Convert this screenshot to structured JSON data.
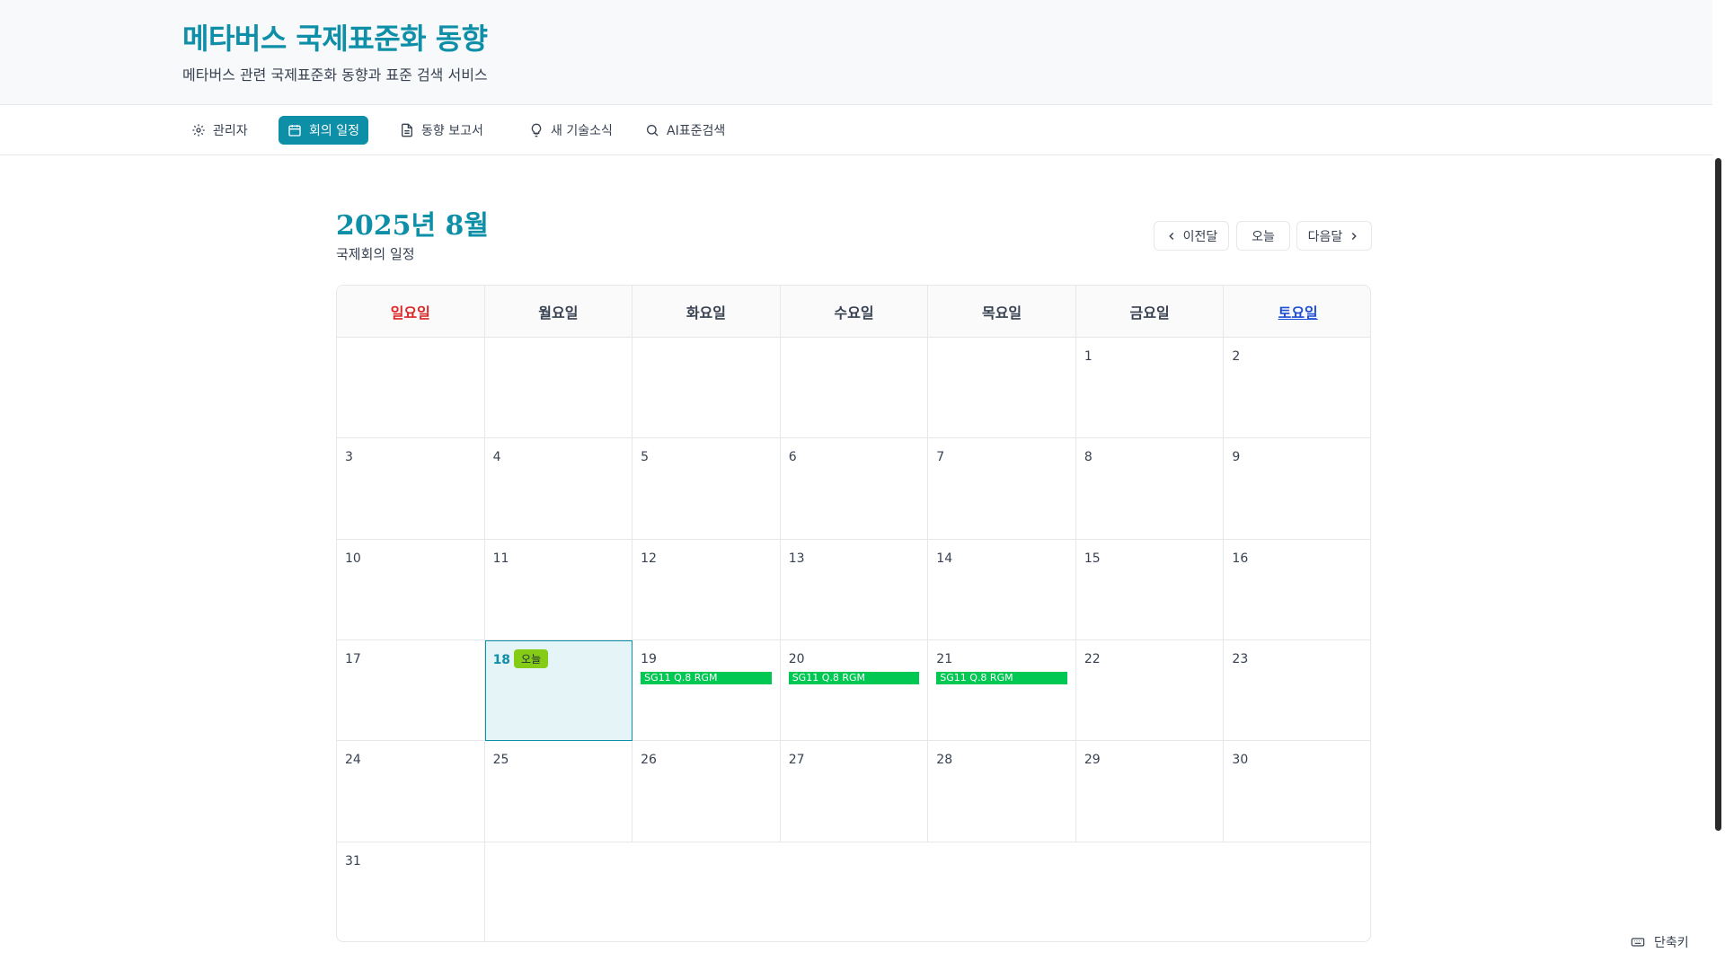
{
  "header": {
    "title": "메타버스 국제표준화 동향",
    "subtitle": "메타버스 관련 국제표준화 동향과 표준 검색 서비스"
  },
  "nav": {
    "items": [
      {
        "label": "관리자",
        "icon": "gear-icon"
      },
      {
        "label": "회의 일정",
        "icon": "calendar-icon",
        "active": true
      },
      {
        "label": "동향 보고서",
        "icon": "document-icon"
      },
      {
        "label": "새 기술소식",
        "icon": "lightbulb-icon"
      },
      {
        "label": "AI표준검색",
        "icon": "search-icon"
      }
    ]
  },
  "calendar": {
    "title": "2025년 8월",
    "subtitle": "국제회의 일정",
    "controls": {
      "prev": "이전달",
      "today": "오늘",
      "next": "다음달"
    },
    "weekdays": [
      "일요일",
      "월요일",
      "화요일",
      "수요일",
      "목요일",
      "금요일",
      "토요일"
    ],
    "first_weekday_index": 5,
    "days_in_month": 31,
    "today": 18,
    "today_badge": "오늘",
    "events": [
      {
        "day": 19,
        "title": "SG11 Q.8 RGM"
      },
      {
        "day": 20,
        "title": "SG11 Q.8 RGM"
      },
      {
        "day": 21,
        "title": "SG11 Q.8 RGM"
      }
    ]
  },
  "shortcut": {
    "label": "단축키",
    "icon": "keyboard-icon"
  },
  "colors": {
    "accent": "#0e8fa8",
    "event": "#00c853",
    "today_badge": "#84cc16",
    "sunday": "#dc2626",
    "saturday": "#1d4ed8"
  }
}
